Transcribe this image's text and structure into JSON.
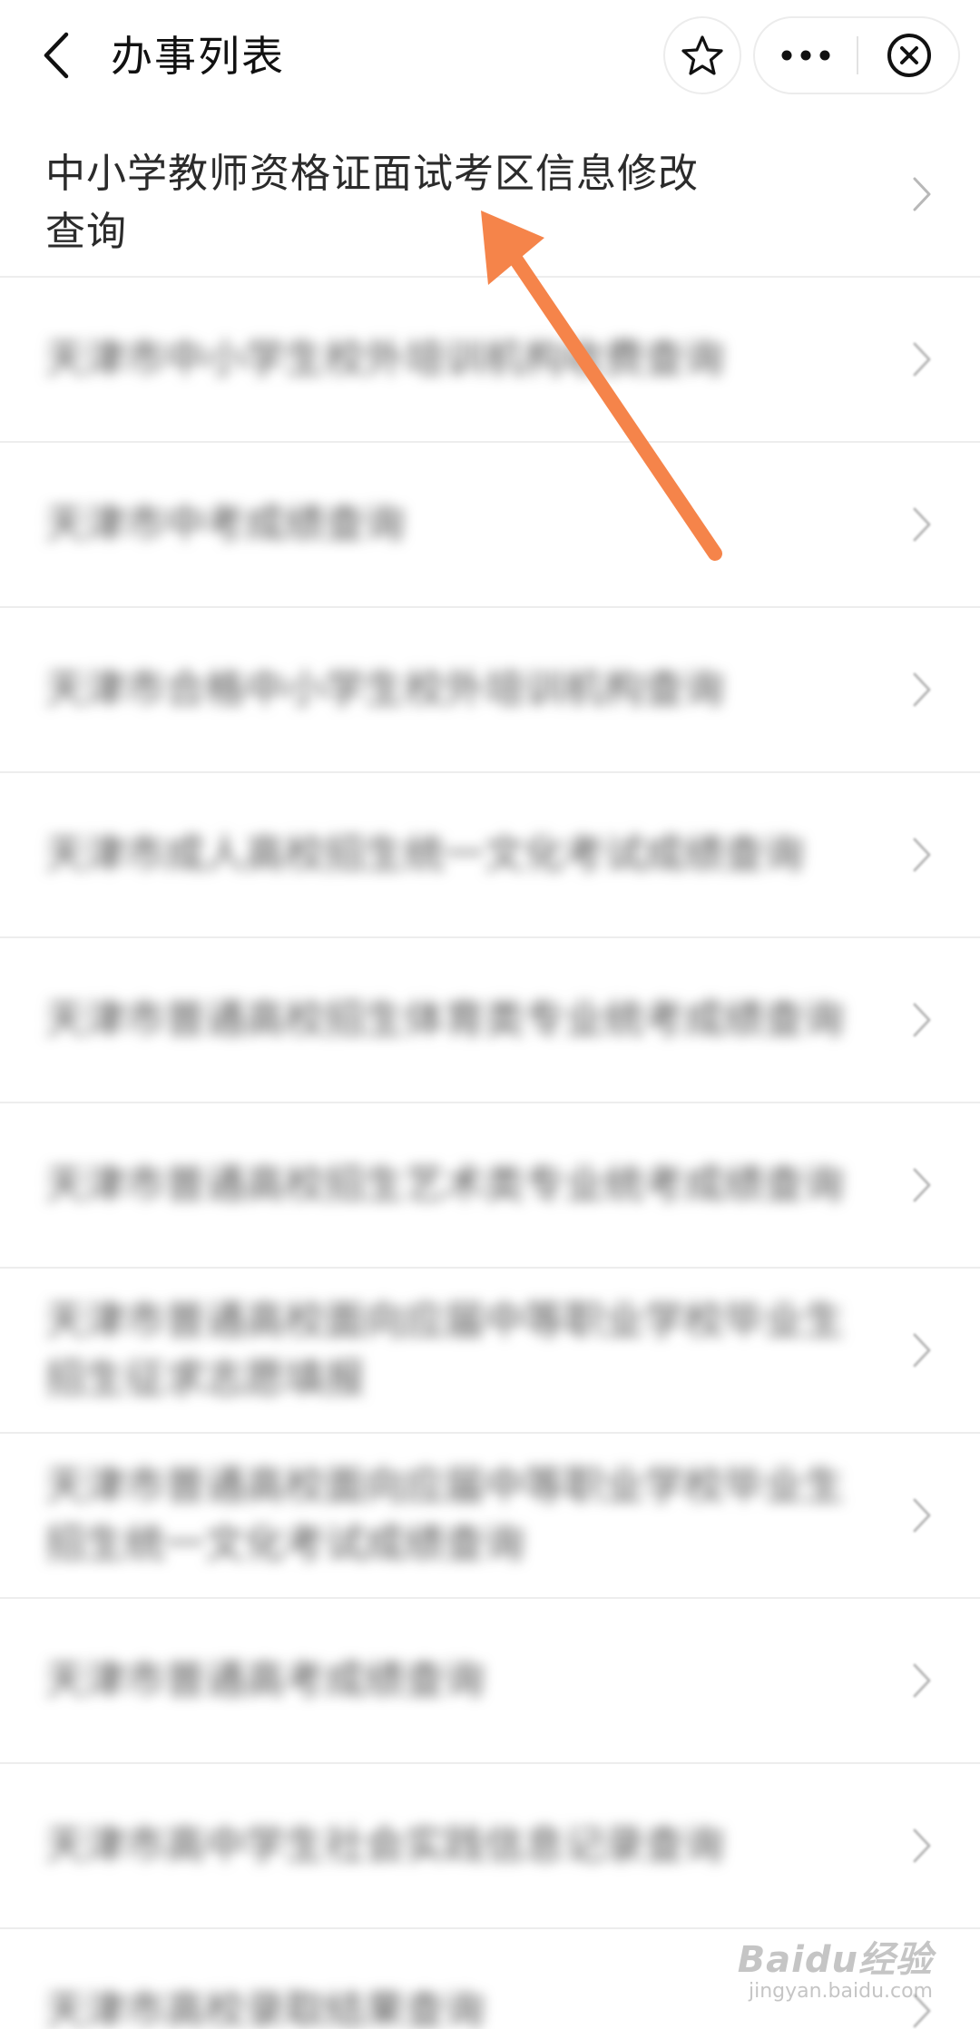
{
  "header": {
    "title": "办事列表",
    "back_icon": "chevron-left-icon",
    "favorite_icon": "star-icon",
    "more_icon": "more-dots-icon",
    "close_icon": "close-circle-icon"
  },
  "list": {
    "items": [
      {
        "label": "中小学教师资格证面试考区信息修改查询",
        "blurred": false
      },
      {
        "label": "天津市中小学生校外培训机构收费查询",
        "blurred": true
      },
      {
        "label": "天津市中考成绩查询",
        "blurred": true
      },
      {
        "label": "天津市合格中小学生校外培训机构查询",
        "blurred": true
      },
      {
        "label": "天津市成人高校招生统一文化考试成绩查询",
        "blurred": true
      },
      {
        "label": "天津市普通高校招生体育类专业统考成绩查询",
        "blurred": true
      },
      {
        "label": "天津市普通高校招生艺术类专业统考成绩查询",
        "blurred": true
      },
      {
        "label": "天津市普通高校面向应届中等职业学校毕业生招生征求志愿填报",
        "blurred": true
      },
      {
        "label": "天津市普通高校面向应届中等职业学校毕业生招生统一文化考试成绩查询",
        "blurred": true
      },
      {
        "label": "天津市普通高考成绩查询",
        "blurred": true
      },
      {
        "label": "天津市高中学生社会实践信息记录查询",
        "blurred": true
      },
      {
        "label": "天津市高校录取结果查询",
        "blurred": true
      }
    ]
  },
  "annotation": {
    "color": "#f5844a"
  },
  "watermark": {
    "brand": "Baidu经验",
    "url": "jingyan.baidu.com"
  }
}
